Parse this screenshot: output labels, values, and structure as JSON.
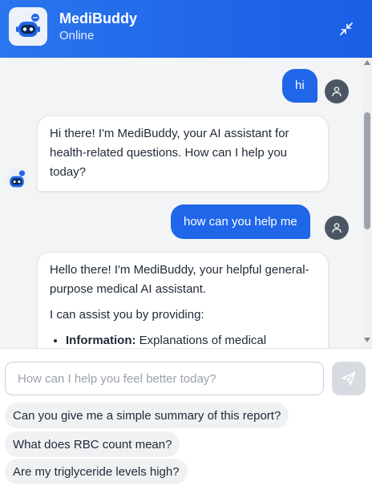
{
  "header": {
    "title": "MediBuddy",
    "status": "Online",
    "minimize_icon": "minimize-arrows-icon",
    "bot_icon": "robot-icon"
  },
  "messages": [
    {
      "role": "user",
      "text": "hi"
    },
    {
      "role": "bot",
      "text": "Hi there! I'm MediBuddy, your AI assistant for health-related questions. How can I help you today?"
    },
    {
      "role": "user",
      "text": "how can you help me"
    },
    {
      "role": "bot",
      "paragraph1": "Hello there! I'm MediBuddy, your helpful general-purpose medical AI assistant.",
      "paragraph2": "I can assist you by providing:",
      "bullet_bold": "Information:",
      "bullet_text": "Explanations of medical"
    }
  ],
  "composer": {
    "placeholder": "How can I help you feel better today?",
    "send_icon": "send-icon"
  },
  "suggestions": [
    "Can you give me a simple summary of this report?",
    "What does RBC count mean?",
    "Are my triglyceride levels high?"
  ],
  "colors": {
    "brand": "#1f66e8",
    "user_bubble": "#1f66e8",
    "chat_bg": "#f3f4f6",
    "avatar_user": "#4b5563"
  }
}
